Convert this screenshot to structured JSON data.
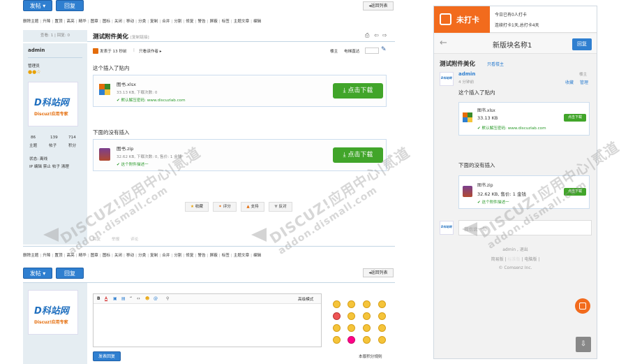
{
  "left": {
    "top_buttons": {
      "post": "发帖",
      "reply": "回复",
      "back": "◂返回列表"
    },
    "mod_actions": [
      "删除主题",
      "升降",
      "置顶",
      "高亮",
      "精华",
      "图章",
      "图标",
      "关闭",
      "移动",
      "分类",
      "复制",
      "合并",
      "分割",
      "修复",
      "警告",
      "屏蔽",
      "标签",
      "主题文章",
      "编辑"
    ],
    "views_replies": "查看: 1  |  回复: 0",
    "thread_title": "测试附件美化",
    "copy_link": "[复制链接]",
    "author": "admin",
    "posted_time": "发表于 13 秒前",
    "only_author": "只看该作者",
    "floor_owner": "楼主",
    "go_to": "电梯直达",
    "user_group": "管理员",
    "logo_text": "D科站网",
    "logo_sub": "Discuz!应用专家",
    "stats": {
      "threads_num": "86",
      "posts_num": "139",
      "points_num": "714",
      "threads_label": "主题",
      "posts_label": "帖子",
      "points_label": "积分"
    },
    "status": "状态: 离线",
    "admin_links": "IP 编辑 禁止 帖子 清理",
    "post_line1": "这个插入了贴内",
    "file1": {
      "name": "图书.xlsx",
      "meta": "33.13 KB, 下载次数: 0",
      "pwd": "默认解压密码: www.discuzlab.com",
      "btn": "点击下载"
    },
    "post_line2": "下面的没有插入",
    "file2": {
      "name": "图书.zip",
      "meta": "32.62 KB, 下载次数: 0, 售价: 1 金钱",
      "desc": "这个附件描述一",
      "btn": "点击下载"
    },
    "actions": [
      "收藏",
      "评分",
      "支持",
      "反对"
    ],
    "footer_links": [
      "回复",
      "举报",
      "评论"
    ],
    "editor": {
      "mode": "高级模式",
      "submit": "发表回复",
      "rules": "本版积分规则"
    }
  },
  "right": {
    "checkin": {
      "label": "未打卡",
      "today": "今日已有0人打卡",
      "streak": "连续打卡1天,总打卡4天"
    },
    "board_name": "新版块名称1",
    "reply_btn": "回复",
    "thread_title": "测试附件美化",
    "only_owner": "只看楼主",
    "author": "admin",
    "time": "4 分钟前",
    "floor": "楼主",
    "fav": "收藏",
    "manage": "管理",
    "line1": "这个插入了贴内",
    "file1": {
      "name": "图书.xlsx",
      "size": "33.13 KB",
      "pwd": "默认解压密码: www.discuzlab.com",
      "btn": "点击下载"
    },
    "line2": "下面的没有插入",
    "file2": {
      "name": "图书.zip",
      "meta": "32.62 KB, 售价: 1 金钱",
      "desc": "这个附件描述一",
      "btn": "点击下载"
    },
    "reply_placeholder": "我也说一句",
    "footer_user": "admin  ,  退出",
    "footer_links": [
      "简易版",
      "标准版",
      "电脑版"
    ],
    "copyright": "© Comsenz Inc."
  },
  "watermark": {
    "text1": "DISCUZ!应用中心|贰道",
    "text2": "addon.dismall.com"
  }
}
